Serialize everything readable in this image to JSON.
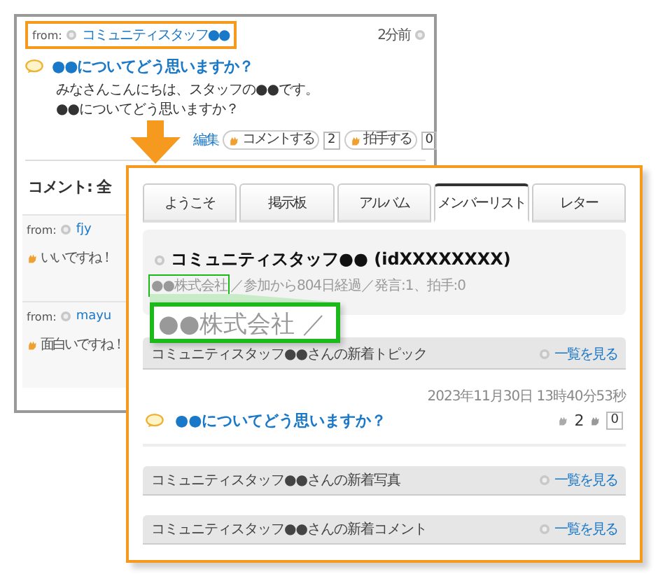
{
  "background_page": {
    "from_label": "from:",
    "author": "コミュニティスタッフ●●",
    "time": "2分前",
    "topic_title": "●●についてどう思いますか？",
    "body": [
      "みなさんこんにちは、スタッフの●●です。",
      "●●についてどう思いますか？"
    ],
    "edit_link": "編集",
    "comment_button": "コメントする",
    "comment_count": "2",
    "clap_button": "拍手する",
    "clap_count": "0",
    "comments_heading": "コメント: 全",
    "comments": [
      {
        "from_label": "from:",
        "author": "fjy",
        "text": "いいですね！"
      },
      {
        "from_label": "from:",
        "author": "mayu",
        "text": "面白いですね！"
      }
    ]
  },
  "panel": {
    "tabs": [
      {
        "label": "ようこそ",
        "selected": false
      },
      {
        "label": "掲示板",
        "selected": false
      },
      {
        "label": "アルバム",
        "selected": false
      },
      {
        "label": "メンバーリスト",
        "selected": true
      },
      {
        "label": "レター",
        "selected": false
      }
    ],
    "profile": {
      "name": "コミュニティスタッフ●● (idXXXXXXXX)",
      "company": "●●株式会社",
      "meta": "／参加から804日経過／発言:1、拍手:0",
      "zoom_text": "●●株式会社 ／"
    },
    "sections": [
      {
        "title": "コミュニティスタッフ●●さんの新着トピック",
        "link": "一覧を見る",
        "topics": [
          {
            "date": "2023年11月30日 13時40分53秒",
            "title": "●●についてどう思いますか？",
            "comment_count": "2",
            "clap_count": "0"
          }
        ]
      },
      {
        "title": "コミュニティスタッフ●●さんの新着写真",
        "link": "一覧を見る"
      },
      {
        "title": "コミュニティスタッフ●●さんの新着コメント",
        "link": "一覧を見る"
      }
    ]
  }
}
